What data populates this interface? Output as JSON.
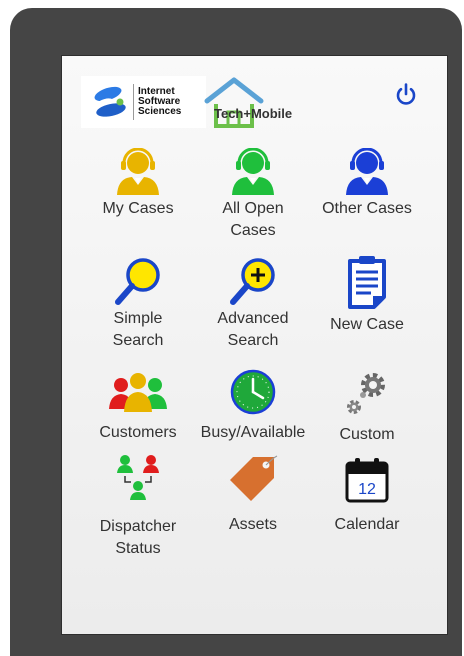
{
  "header": {
    "company_line1": "Internet",
    "company_line2": "Software",
    "company_line3": "Sciences",
    "app_name": "Tech+Mobile",
    "power_icon": "power-icon"
  },
  "menu": {
    "my_cases": "My Cases",
    "all_open_cases_line1": "All Open",
    "all_open_cases_line2": "Cases",
    "other_cases": "Other Cases",
    "simple_search_line1": "Simple",
    "simple_search_line2": "Search",
    "advanced_search_line1": "Advanced",
    "advanced_search_line2": "Search",
    "new_case": "New Case",
    "customers": "Customers",
    "busy_available": "Busy/Available",
    "custom": "Custom",
    "dispatcher_status_line1": "Dispatcher",
    "dispatcher_status_line2": "Status",
    "assets": "Assets",
    "calendar": "Calendar",
    "calendar_day": "12"
  },
  "colors": {
    "device_frame": "#454545",
    "accent_blue": "#1a46c8",
    "agent_yellow": "#e8b400",
    "agent_green": "#1fbf3c",
    "agent_blue": "#1b3fd6",
    "agent_red": "#e01d1d",
    "asset_tag": "#d7702f",
    "house_blue": "#5aa2d6",
    "house_green": "#6cc04a"
  }
}
